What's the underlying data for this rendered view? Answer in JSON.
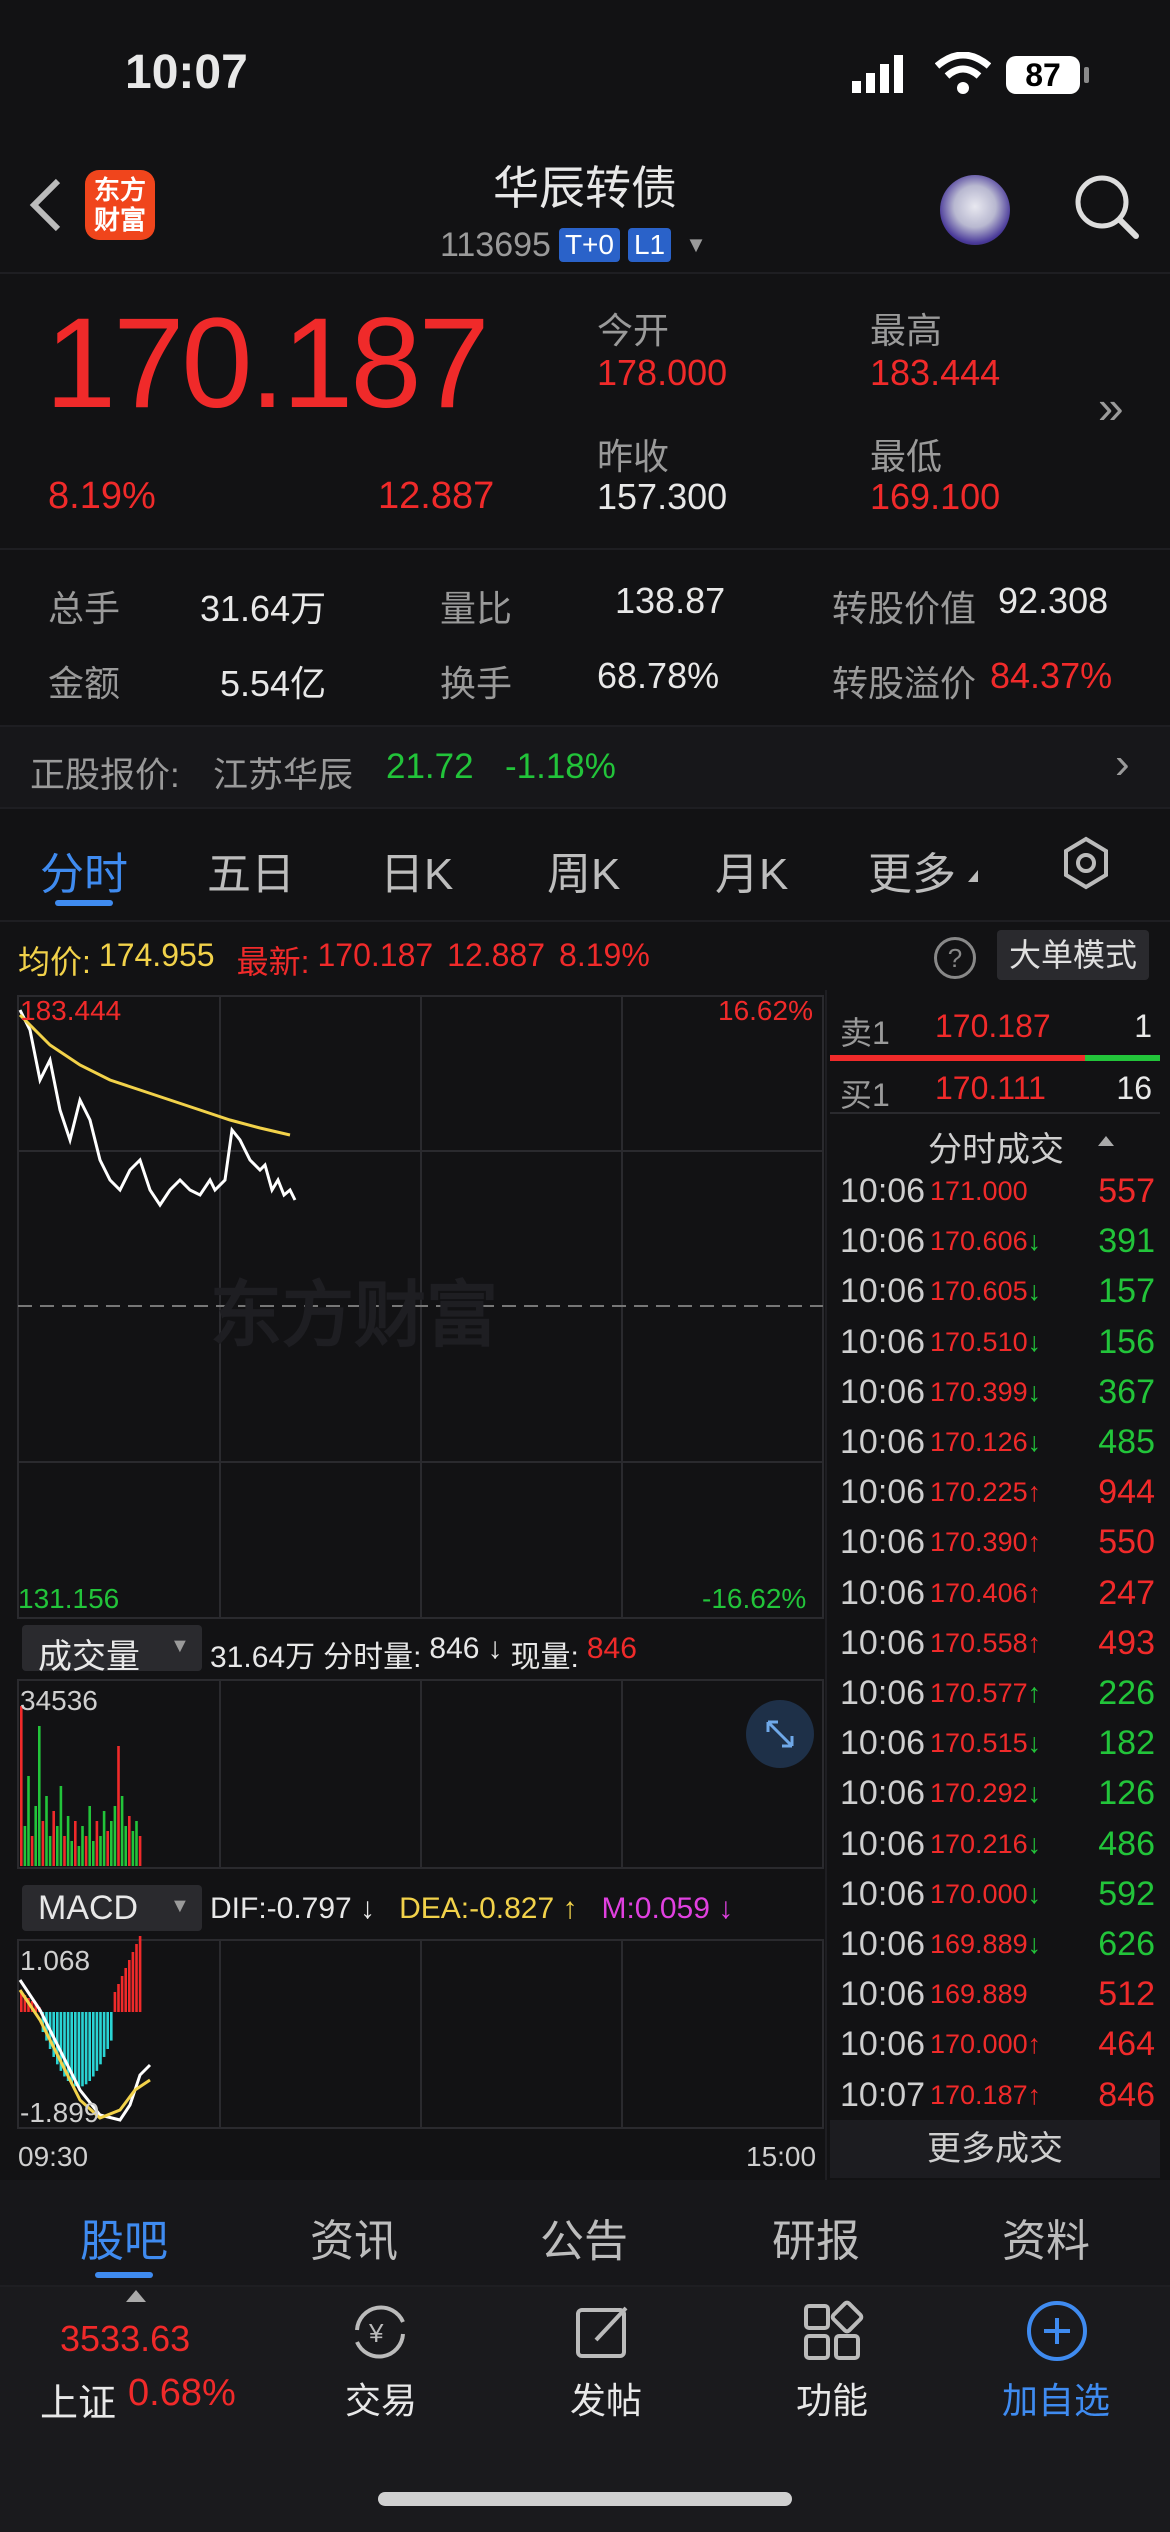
{
  "status_bar": {
    "time": "10:07",
    "battery": "87"
  },
  "header": {
    "logo_text_1": "东方",
    "logo_text_2": "财富",
    "title": "华辰转债",
    "code": "113695",
    "badge_t0": "T+0",
    "badge_l1": "L1"
  },
  "quote": {
    "price": "170.187",
    "change_pct": "8.19%",
    "change": "12.887",
    "open_label": "今开",
    "open": "178.000",
    "high_label": "最高",
    "high": "183.444",
    "prev_label": "昨收",
    "prev": "157.300",
    "low_label": "最低",
    "low": "169.100"
  },
  "stats": {
    "vol_label": "总手",
    "vol": "31.64万",
    "amount_label": "金额",
    "amount": "5.54亿",
    "ratio_label": "量比",
    "ratio": "138.87",
    "turnover_label": "换手",
    "turnover": "68.78%",
    "conv_value_label": "转股价值",
    "conv_value": "92.308",
    "premium_label": "转股溢价",
    "premium": "84.37%"
  },
  "underlying": {
    "label": "正股报价:",
    "name": "江苏华辰",
    "price": "21.72",
    "change": "-1.18%"
  },
  "tabs": [
    "分时",
    "五日",
    "日K",
    "周K",
    "月K",
    "更多"
  ],
  "info_line": {
    "avg_label": "均价:",
    "avg": "174.955",
    "latest_label": "最新:",
    "latest": "170.187",
    "change": "12.887",
    "pct": "8.19%",
    "mode_button": "大单模式"
  },
  "chart": {
    "price_max": "183.444",
    "pct_max": "16.62%",
    "price_min": "131.156",
    "pct_min": "-16.62%",
    "watermark": "东方财富",
    "vol_selector": "成交量",
    "vol_total": "31.64万",
    "vol_period_label": "分时量:",
    "vol_period": "846",
    "vol_arrow": "↓",
    "vol_now_label": "现量:",
    "vol_now": "846",
    "vol_max": "34536",
    "macd_selector": "MACD",
    "dif": "DIF:-0.797 ↓",
    "dea": "DEA:-0.827 ↑",
    "m": "M:0.059 ↓",
    "macd_max": "1.068",
    "macd_min": "-1.899",
    "time_start": "09:30",
    "time_end": "15:00"
  },
  "orderbook": {
    "sell1_label": "卖1",
    "sell1_price": "170.187",
    "sell1_vol": "1",
    "buy1_label": "买1",
    "buy1_price": "170.111",
    "buy1_vol": "16",
    "trades_title": "分时成交",
    "trades": [
      {
        "t": "10:06",
        "p": "171.000",
        "a": "",
        "v": "557",
        "c": "red"
      },
      {
        "t": "10:06",
        "p": "170.606",
        "a": "↓",
        "v": "391",
        "c": "green"
      },
      {
        "t": "10:06",
        "p": "170.605",
        "a": "↓",
        "v": "157",
        "c": "green"
      },
      {
        "t": "10:06",
        "p": "170.510",
        "a": "↓",
        "v": "156",
        "c": "green"
      },
      {
        "t": "10:06",
        "p": "170.399",
        "a": "↓",
        "v": "367",
        "c": "green"
      },
      {
        "t": "10:06",
        "p": "170.126",
        "a": "↓",
        "v": "485",
        "c": "green"
      },
      {
        "t": "10:06",
        "p": "170.225",
        "a": "↑",
        "v": "944",
        "c": "red"
      },
      {
        "t": "10:06",
        "p": "170.390",
        "a": "↑",
        "v": "550",
        "c": "red"
      },
      {
        "t": "10:06",
        "p": "170.406",
        "a": "↑",
        "v": "247",
        "c": "red"
      },
      {
        "t": "10:06",
        "p": "170.558",
        "a": "↑",
        "v": "493",
        "c": "red"
      },
      {
        "t": "10:06",
        "p": "170.577",
        "a": "↑",
        "v": "226",
        "c": "green"
      },
      {
        "t": "10:06",
        "p": "170.515",
        "a": "↓",
        "v": "182",
        "c": "green"
      },
      {
        "t": "10:06",
        "p": "170.292",
        "a": "↓",
        "v": "126",
        "c": "green"
      },
      {
        "t": "10:06",
        "p": "170.216",
        "a": "↓",
        "v": "486",
        "c": "green"
      },
      {
        "t": "10:06",
        "p": "170.000",
        "a": "↓",
        "v": "592",
        "c": "green"
      },
      {
        "t": "10:06",
        "p": "169.889",
        "a": "↓",
        "v": "626",
        "c": "green"
      },
      {
        "t": "10:06",
        "p": "169.889",
        "a": "",
        "v": "512",
        "c": "red"
      },
      {
        "t": "10:06",
        "p": "170.000",
        "a": "↑",
        "v": "464",
        "c": "red"
      },
      {
        "t": "10:07",
        "p": "170.187",
        "a": "↑",
        "v": "846",
        "c": "red"
      }
    ],
    "more_trades": "更多成交"
  },
  "bottom_tabs": [
    "股吧",
    "资讯",
    "公告",
    "研报",
    "资料"
  ],
  "bottom_nav": {
    "index_value": "3533.63",
    "index_name": "上证",
    "index_pct": "0.68%",
    "trade": "交易",
    "post": "发帖",
    "functions": "功能",
    "add_watch": "加自选"
  },
  "colors": {
    "up": "#f02a2a",
    "down": "#22c43a",
    "avg_line": "#f2d24a",
    "accent": "#3f8bf0"
  }
}
